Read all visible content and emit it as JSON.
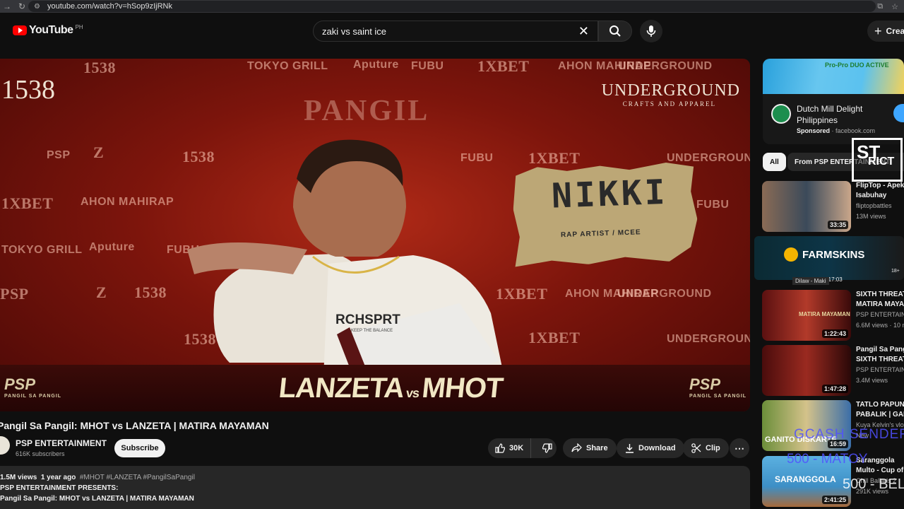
{
  "browser": {
    "url": "youtube.com/watch?v=hSop9zIjRNk"
  },
  "masthead": {
    "logo_text": "YouTube",
    "country_code": "PH",
    "search_value": "zaki vs saint ice",
    "create_label": "Crea"
  },
  "player": {
    "sponsors": [
      "1538",
      "Z",
      "TOKYO GRILL",
      "Aputure",
      "FUBU",
      "1XBET",
      "AHON MAHIRAP",
      "UNDERGROUND",
      "PSP"
    ],
    "underground": "UNDERGROUND",
    "underground_sub": "CRAFTS AND APPAREL",
    "jewellery_brand": "1538",
    "backdrop_title": "PANGIL",
    "shirt_text": "RCHSPRT",
    "shirt_sub": "KEEP THE BALANCE",
    "name_card": "NIKKI",
    "name_card_sub": "RAP ARTIST / MCEE",
    "matchup_left": "LANZETA",
    "matchup_vs": "vs",
    "matchup_right": "MHOT",
    "psp_logo": "PSP",
    "psp_logo_sub": "PANGIL SA PANGIL"
  },
  "video": {
    "title": "Pangil Sa Pangil: MHOT vs LANZETA | MATIRA MAYAMAN",
    "channel": "PSP ENTERTAINMENT",
    "subscribers": "616K subscribers",
    "subscribe_label": "Subscribe",
    "like_count": "30K",
    "share_label": "Share",
    "download_label": "Download",
    "clip_label": "Clip"
  },
  "description": {
    "views": "1.5M views",
    "age": "1 year ago",
    "tags": "#MHOT #LANZETA #PangilSaPangil",
    "line1": "PSP ENTERTAINMENT PRESENTS:",
    "line2": "Pangil Sa Pangil: MHOT vs LANZETA | MATIRA MAYAMAN"
  },
  "ad": {
    "title": "Dutch Mill Delight Philippines",
    "sponsored": "Sponsored",
    "domain": "· facebook.com",
    "banner": "Pro-Pro DUO ACTIVE"
  },
  "chips": [
    "All",
    "From PSP ENTERTAINMENT"
  ],
  "recommendations": [
    {
      "title": "FlipTop - Apekz vs",
      "title2": "Isabuhay",
      "channel": "fliptopbattles",
      "views": "13M views",
      "duration": "33:35"
    },
    {
      "title": "SIXTH THREAT vs",
      "title2": "MATIRA MAYAMAN",
      "channel": "PSP ENTERTAINMENT",
      "views": "6.6M views · 10 mo",
      "duration": "1:22:43",
      "thumb_text": "MATIRA MAYAMAN"
    },
    {
      "title": "Pangil Sa Pangil:",
      "title2": "SIXTH THREAT",
      "channel": "PSP ENTERTAINMENT",
      "views": "3.4M views",
      "duration": "1:47:28"
    },
    {
      "title": "TATLO PAPUNTA",
      "title2": "PABALIK | GANITO",
      "channel": "Kuya Kelvin's vlog",
      "views": "New",
      "duration": "16:59",
      "thumb_text": "GANITO DISKARTE"
    },
    {
      "title": "Saranggola",
      "title2": "Multo - Cup of",
      "channel": "Chill Ballads 2",
      "views": "291K views",
      "duration": "2:41:25",
      "thumb_text": "SARANGGOLA"
    }
  ],
  "farmskins": {
    "label": "FARMSKINS",
    "duration": "1:17:03",
    "caption": "Dilaw - Maki",
    "badge": "18+"
  },
  "stream_overlay": {
    "logo_top": "ST",
    "logo_bottom": "RICT",
    "text1": "GCASH SENDER",
    "text2": "500 - MATOY",
    "text3": "500 - BELLA"
  }
}
